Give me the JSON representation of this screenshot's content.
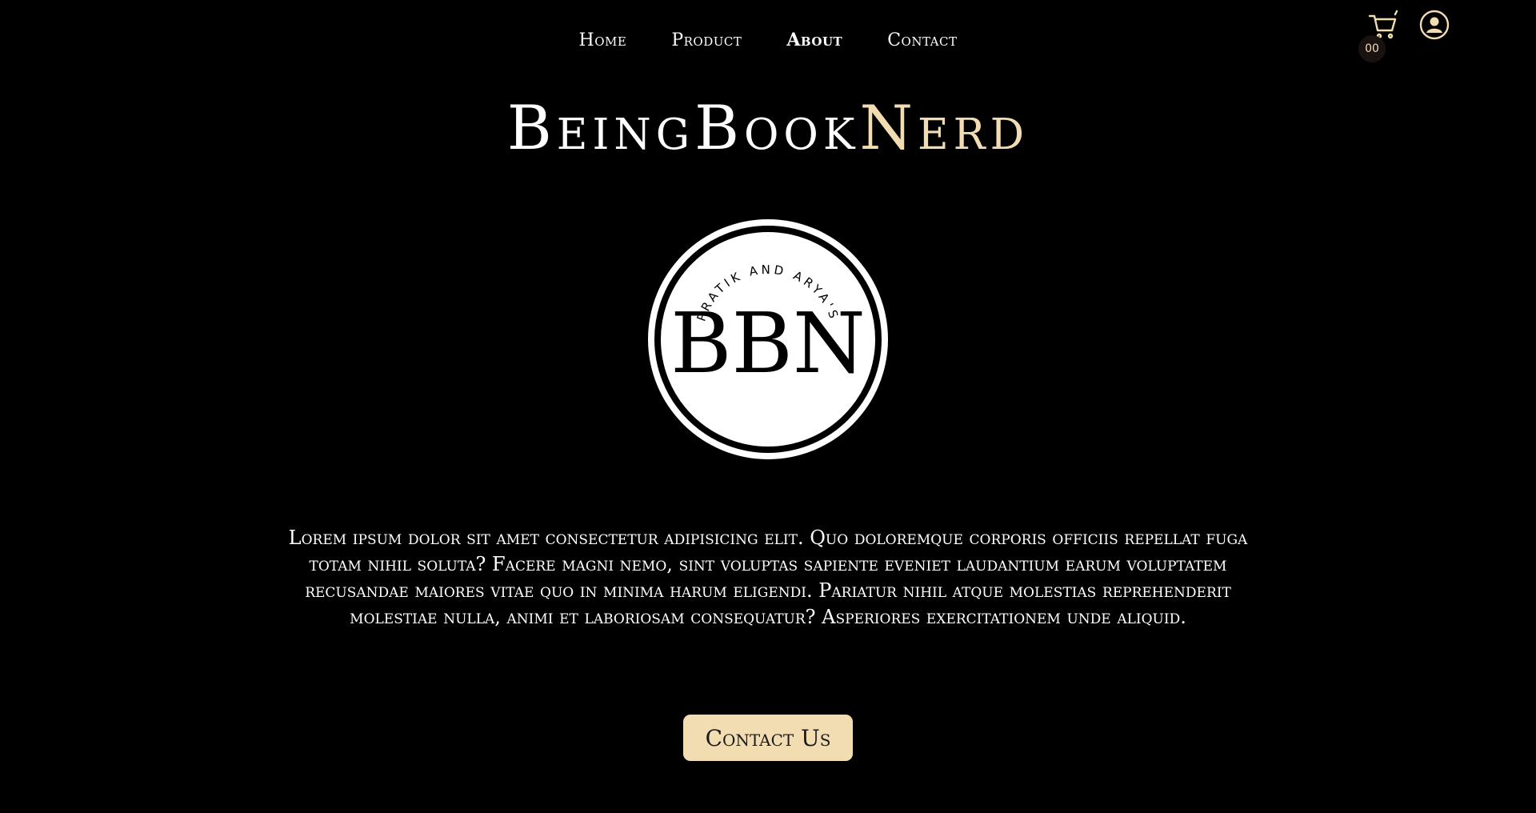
{
  "nav": {
    "items": [
      {
        "label": "Home"
      },
      {
        "label": "Product"
      },
      {
        "label": "About"
      },
      {
        "label": "Contact"
      }
    ]
  },
  "cart": {
    "count": "00",
    "icon": "cart-icon"
  },
  "user": {
    "icon": "user-icon"
  },
  "brand": {
    "part1": "BeingBook",
    "part2": "Nerd"
  },
  "logo": {
    "arc_text": "PRATIK AND ARYA'S",
    "monogram": "BBN"
  },
  "about": {
    "text": "Lorem ipsum dolor sit amet consectetur adipisicing elit. Quo doloremque corporis officiis repellat fuga totam nihil soluta? Facere magni nemo, sint voluptas sapiente eveniet laudantium earum voluptatem recusandae maiores vitae quo in minima harum eligendi. Pariatur nihil atque molestias reprehenderit molestiae nulla, animi et laboriosam consequatur? Asperiores exercitationem unde aliquid."
  },
  "cta": {
    "label": "Contact Us"
  },
  "colors": {
    "background": "#000000",
    "accent": "#f2ddb3",
    "text": "#ffffff"
  }
}
